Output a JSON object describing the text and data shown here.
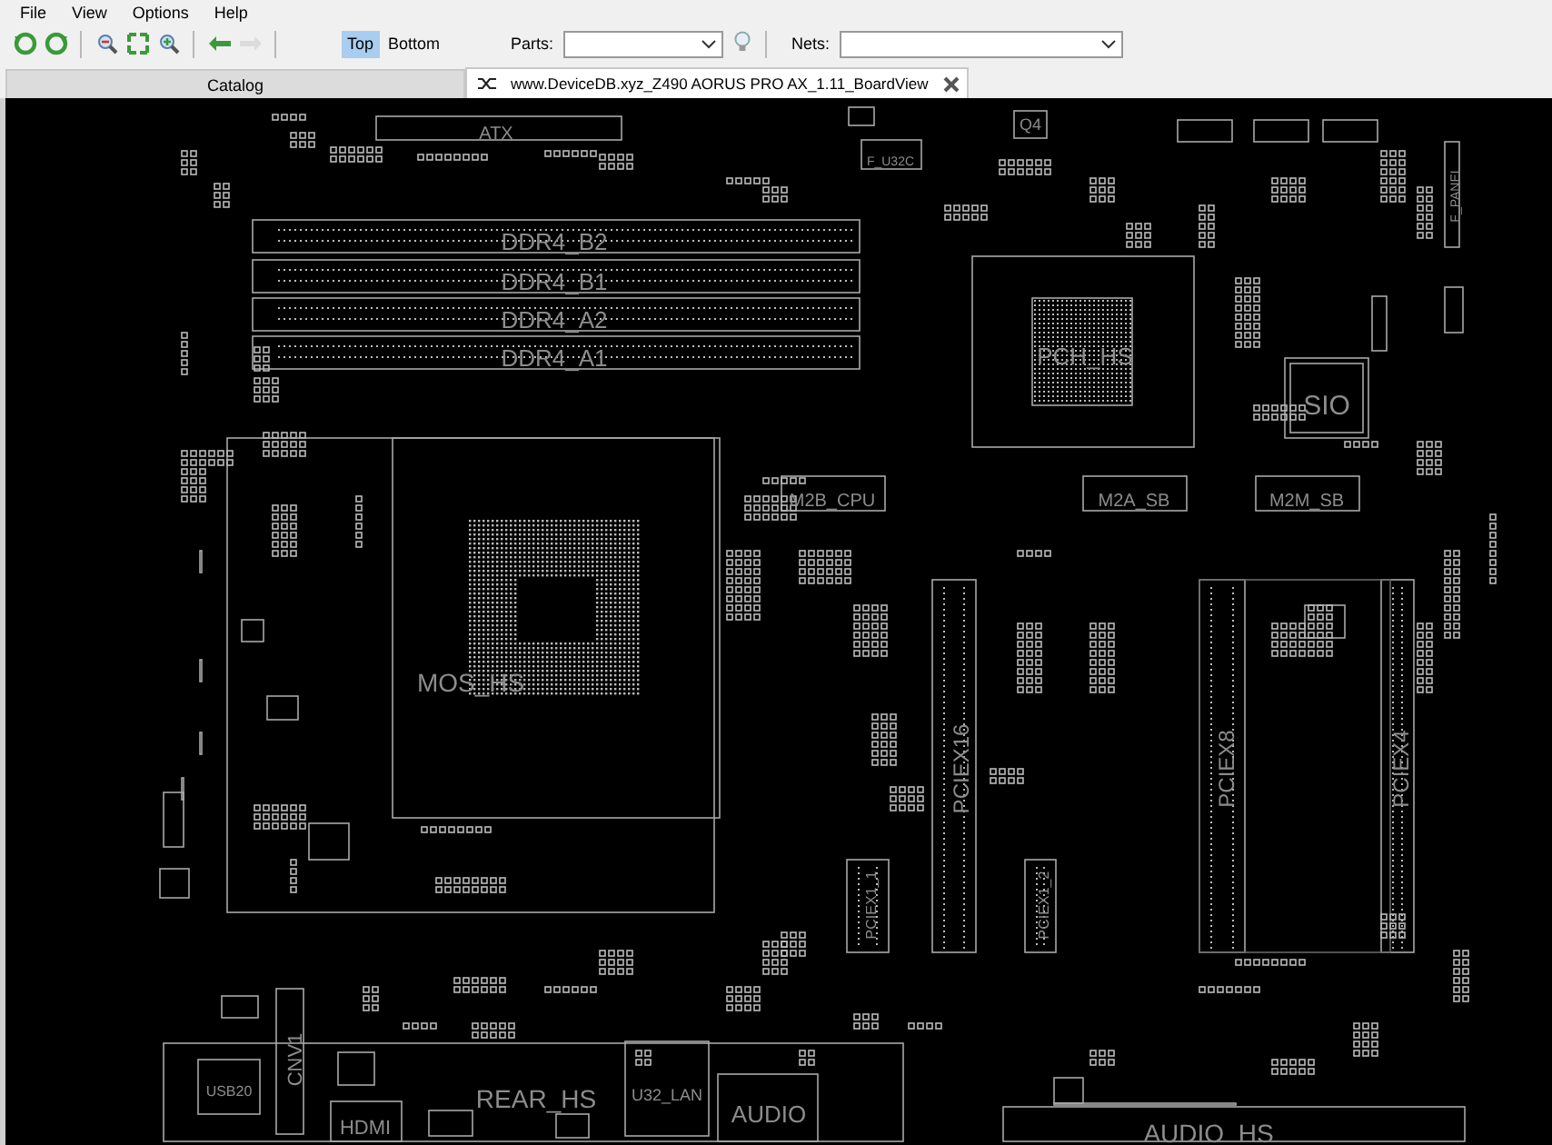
{
  "menu": [
    {
      "label": "File"
    },
    {
      "label": "View"
    },
    {
      "label": "Options"
    },
    {
      "label": "Help"
    }
  ],
  "toolbar": {
    "tools": [
      {
        "kind": "rotate-left",
        "disabled": false
      },
      {
        "kind": "rotate-right",
        "disabled": false
      },
      {
        "kind": "zoom-out",
        "disabled": false
      },
      {
        "kind": "fit",
        "disabled": false
      },
      {
        "kind": "zoom-in",
        "disabled": false
      },
      {
        "kind": "back",
        "disabled": false
      },
      {
        "kind": "forward",
        "disabled": true
      }
    ],
    "sides": [
      {
        "label": "Top",
        "selected": true
      },
      {
        "label": "Bottom",
        "selected": false
      }
    ],
    "parts": {
      "label": "Parts:"
    },
    "nets": {
      "label": "Nets:"
    }
  },
  "tabs": [
    {
      "label": "Catalog",
      "selected": false
    },
    {
      "label": "www.DeviceDB.xyz_Z490 AORUS PRO AX_1.11_BoardView",
      "selected": true
    }
  ],
  "board": {
    "labels": [
      {
        "text": "ATX"
      },
      {
        "text": "DDR4_B2"
      },
      {
        "text": "DDR4_B1"
      },
      {
        "text": "DDR4_A2"
      },
      {
        "text": "DDR4_A1"
      },
      {
        "text": "Q4"
      },
      {
        "text": "F_U32C"
      },
      {
        "text": "F_PANEL"
      },
      {
        "text": "PCH_HS"
      },
      {
        "text": "SIO"
      },
      {
        "text": "M2B_CPU"
      },
      {
        "text": "M2A_SB"
      },
      {
        "text": "M2M_SB"
      },
      {
        "text": "MOS_HS"
      },
      {
        "text": "PCIEX16"
      },
      {
        "text": "PCIEX1_1"
      },
      {
        "text": "PCIEX1_2"
      },
      {
        "text": "PCIEX8"
      },
      {
        "text": "PCIEX4"
      },
      {
        "text": "USB20"
      },
      {
        "text": "CNV1"
      },
      {
        "text": "HDMI"
      },
      {
        "text": "REAR_HS"
      },
      {
        "text": "U32_LAN"
      },
      {
        "text": "AUDIO"
      },
      {
        "text": "AUDIO_HS"
      }
    ]
  }
}
